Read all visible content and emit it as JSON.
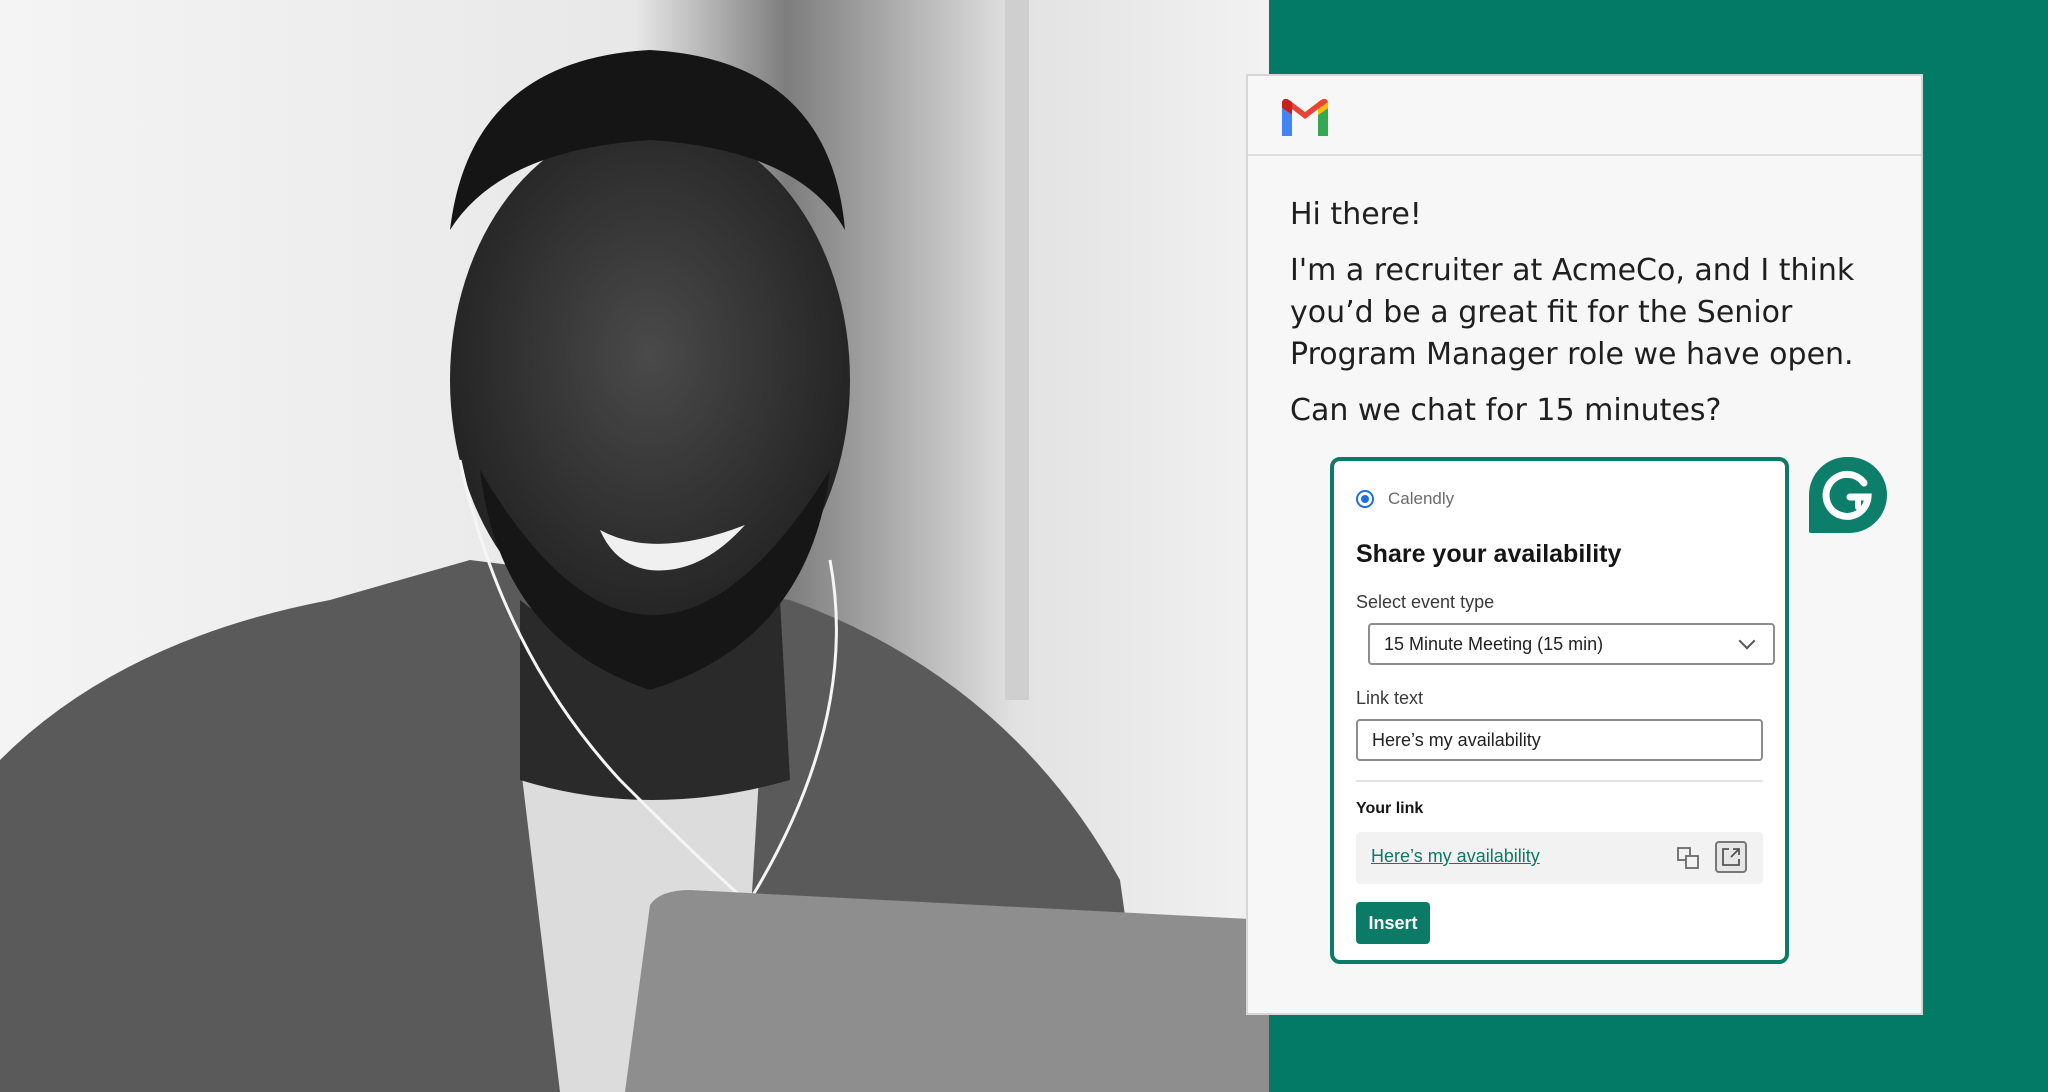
{
  "photo": {
    "description_icon": "person-on-laptop-photo"
  },
  "colors": {
    "brand_green": "#037a66",
    "calendly_blue": "#1d6fe0"
  },
  "email": {
    "app_icon": "gmail-icon",
    "greeting": "Hi there!",
    "paragraph": "I'm a recruiter at AcmeCo, and I think you’d be a great fit for the Senior Program Manager role we have open.",
    "question": "Can we chat for 15 minutes?"
  },
  "calendly": {
    "brand": "Calendly",
    "title": "Share your availability",
    "event_type_label": "Select event type",
    "event_type_value": "15 Minute Meeting (15 min)",
    "link_text_label": "Link text",
    "link_text_value": "Here’s my availability",
    "your_link_label": "Your link",
    "your_link_value": "Here’s my availability",
    "insert_label": "Insert"
  },
  "grammarly": {
    "icon": "grammarly-icon"
  }
}
